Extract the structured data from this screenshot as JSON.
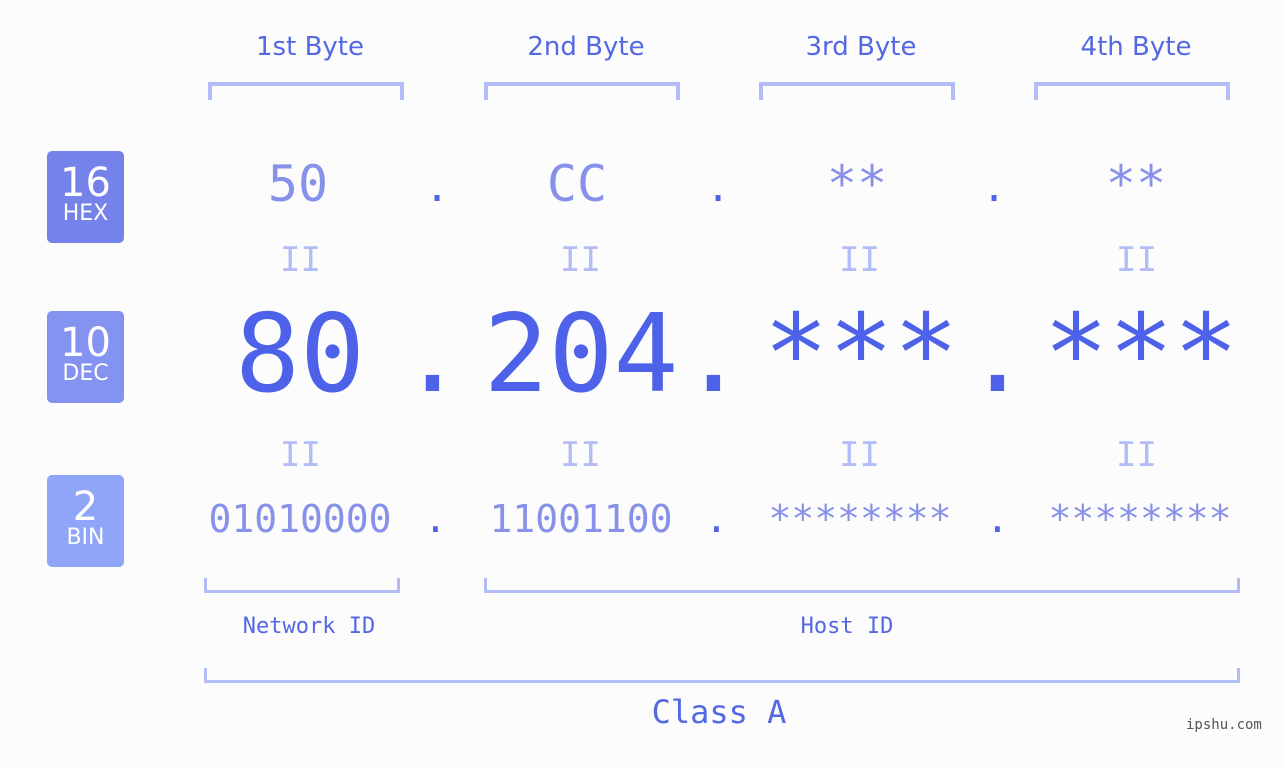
{
  "headers": [
    "1st Byte",
    "2nd Byte",
    "3rd Byte",
    "4th Byte"
  ],
  "badges": {
    "hex": {
      "num": "16",
      "label": "HEX",
      "color": "#7482ea"
    },
    "dec": {
      "num": "10",
      "label": "DEC",
      "color": "#8492f0"
    },
    "bin": {
      "num": "2",
      "label": "BIN",
      "color": "#8fa6f8"
    }
  },
  "hex": [
    "50",
    "CC",
    "**",
    "**"
  ],
  "dec": [
    "80",
    "204",
    "***",
    "***"
  ],
  "bin": [
    "01010000",
    "11001100",
    "********",
    "********"
  ],
  "separator": ".",
  "equals": "II",
  "network_label": "Network ID",
  "host_label": "Host ID",
  "class_label": "Class A",
  "watermark": "ipshu.com"
}
